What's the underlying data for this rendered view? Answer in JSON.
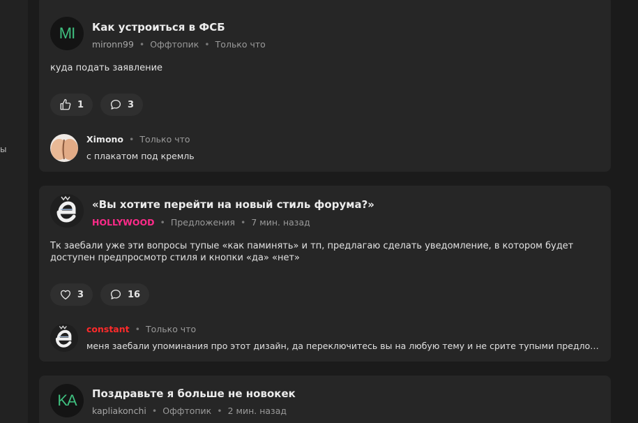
{
  "left_strip": {
    "stub_text": "ы"
  },
  "posts": [
    {
      "avatar_initials": "MI",
      "title": "Как устроиться в ФСБ",
      "author": "mironn99",
      "category": "Оффтопик",
      "time": "Только что",
      "body": "куда подать заявление",
      "likes": "1",
      "comments": "3",
      "comment": {
        "author": "Ximono",
        "time": "Только что",
        "text": "с плакатом под кремль"
      }
    },
    {
      "title": "«Вы хотите перейти на новый стиль форума?»",
      "author": "HOLLYWOOD",
      "category": "Предложения",
      "time": "7 мин. назад",
      "body": "Тк заебали уже эти вопросы тупые «как паминять» и тп, предлагаю сделать уведомление, в котором будет доступен предпросмотр стиля и кнопки «да» «нет»",
      "likes": "3",
      "comments": "16",
      "comment": {
        "author": "constant",
        "time": "Только что",
        "text": "меня заебали упоминания про этот дизайн, да переключитесь вы на любую тему и не срите тупыми предложени..."
      }
    },
    {
      "avatar_initials": "KA",
      "title": "Поздравьте я больше не новокек",
      "author": "kapliakonchi",
      "category": "Оффтопик",
      "time": "2 мин. назад"
    }
  ],
  "meta_separator": "•",
  "icons": {
    "like": "thumbs-up-icon",
    "heart": "heart-icon",
    "comment": "comment-bubble-icon"
  },
  "colors": {
    "background": "#1b1b1b",
    "card": "#262626",
    "pill": "#2f2f2f",
    "accent_green": "#3fbf7f",
    "hollywood_pink": "#ff2b8a",
    "constant_red": "#ff2a2a"
  }
}
